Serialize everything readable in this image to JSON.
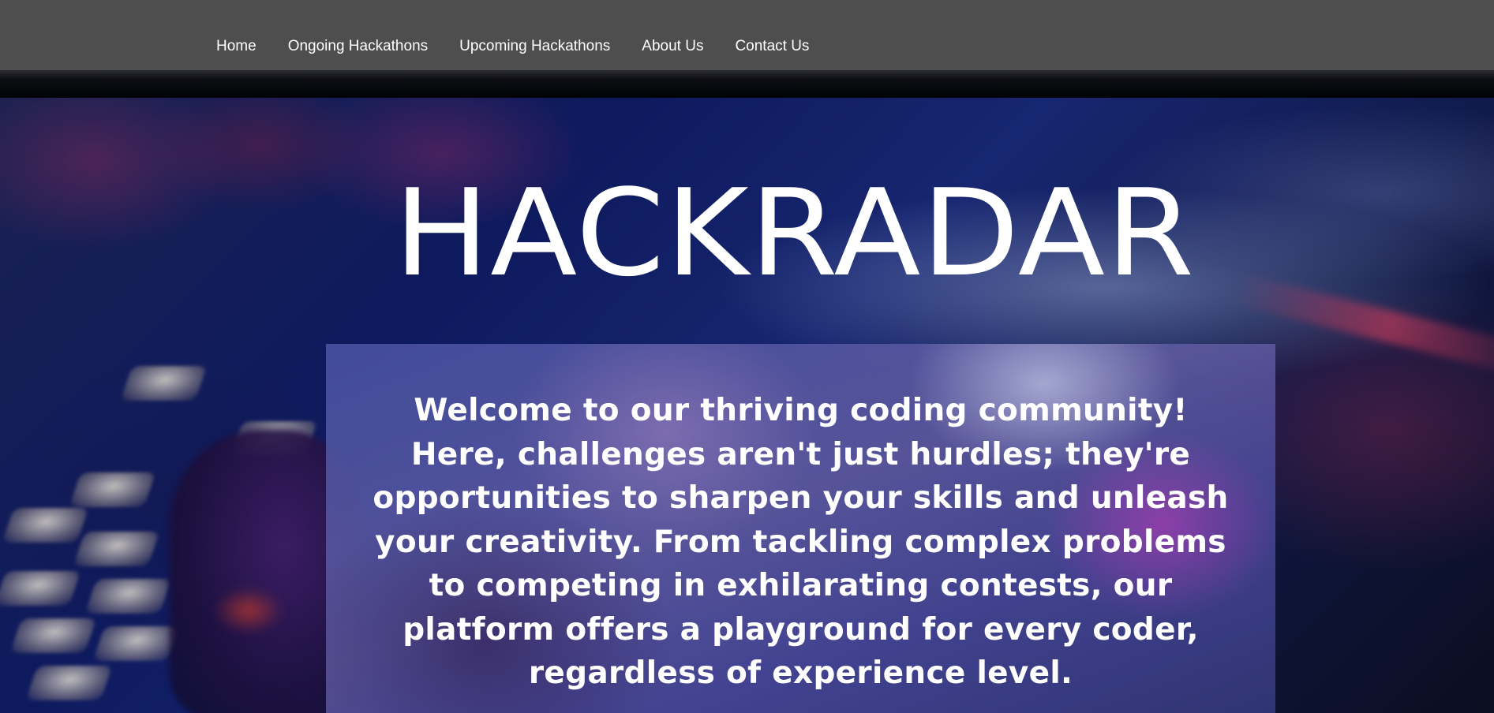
{
  "nav": {
    "items": [
      {
        "label": "Home"
      },
      {
        "label": "Ongoing Hackathons"
      },
      {
        "label": "Upcoming Hackathons"
      },
      {
        "label": "About Us"
      },
      {
        "label": "Contact Us"
      }
    ]
  },
  "hero": {
    "title": "HACKRADAR",
    "welcome_text": "Welcome to our thriving coding community! Here, challenges aren't just hurdles; they're opportunities to sharpen your skills and unleash your creativity. From tackling complex problems to competing in exhilarating contests, our platform offers a playground for every coder, regardless of experience level."
  },
  "colors": {
    "navbar_background": "#4e4e4e",
    "nav_text": "#ffffff",
    "title_text": "#ffffff"
  }
}
